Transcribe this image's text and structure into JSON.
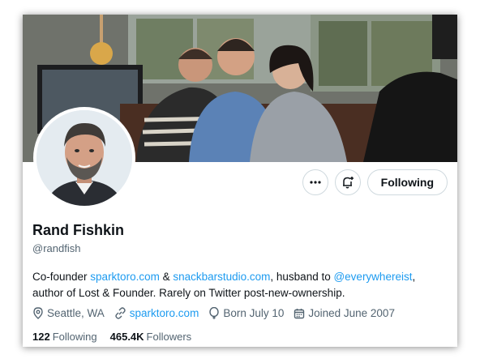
{
  "profile": {
    "display_name": "Rand Fishkin",
    "handle": "@randfish",
    "bio": {
      "part1": "Co-founder ",
      "link1": "sparktoro.com",
      "part2": " & ",
      "link2": "snackbarstudio.com",
      "part3": ", husband to ",
      "link3": "@everywhereist",
      "part4": ",",
      "line2": "author of Lost & Founder. Rarely on Twitter post-new-ownership."
    },
    "location": "Seattle, WA",
    "website": "sparktoro.com",
    "birthday": "Born July 10",
    "joined": "Joined June 2007",
    "following_count": "122",
    "following_label": "Following",
    "followers_count": "465.4K",
    "followers_label": "Followers"
  },
  "actions": {
    "more_icon": "more-icon",
    "notify_icon": "bell-plus-icon",
    "following_button": "Following"
  },
  "colors": {
    "accent": "#1d9bf0",
    "text": "#0f1419",
    "secondary": "#536471"
  }
}
